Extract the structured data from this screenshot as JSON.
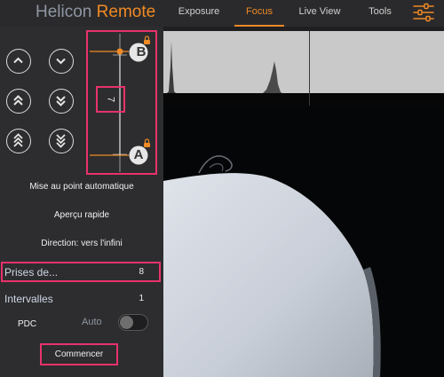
{
  "app": {
    "brand_prefix": "Helicon",
    "brand_suffix": "Remote"
  },
  "tabs": [
    {
      "label": "Exposure",
      "active": false
    },
    {
      "label": "Focus",
      "active": true
    },
    {
      "label": "Live View",
      "active": false
    },
    {
      "label": "Tools",
      "active": false
    }
  ],
  "focus_slider": {
    "top_label": "B",
    "bottom_label": "A",
    "step_value": "7"
  },
  "menu": {
    "autofocus": "Mise au point automatique",
    "preview": "Aperçu rapide",
    "direction": "Direction: vers l'infini"
  },
  "shots": {
    "label": "Prises de...",
    "value": "8"
  },
  "intervals": {
    "label": "Intervalles",
    "value": "1"
  },
  "dof": {
    "label": "PDC",
    "auto_label": "Auto",
    "auto_enabled": false
  },
  "start_button": "Commencer",
  "colors": {
    "accent": "#f08a24",
    "highlight": "#e8326c",
    "background": "#2d2d2f"
  },
  "icons": [
    "chevron-up-icon",
    "chevron-down-icon",
    "double-chevron-up-icon",
    "double-chevron-down-icon",
    "triple-chevron-up-icon",
    "triple-chevron-down-icon",
    "lock-icon",
    "settings-sliders-icon"
  ]
}
